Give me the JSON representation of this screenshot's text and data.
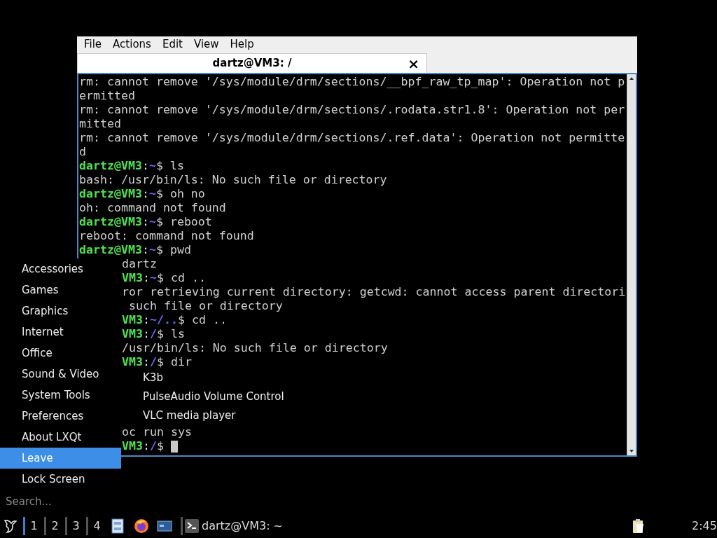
{
  "terminal": {
    "menu_bar": [
      "File",
      "Actions",
      "Edit",
      "View",
      "Help"
    ],
    "tabs": [
      {
        "title": "dartz@VM3: /",
        "selected": true,
        "close": "×"
      }
    ],
    "lines": [
      {
        "kind": "text",
        "text": "rm: cannot remove '/sys/module/drm/sections/__bpf_raw_tp_map': Operation not p"
      },
      {
        "kind": "text",
        "text": "ermitted"
      },
      {
        "kind": "text",
        "text": "rm: cannot remove '/sys/module/drm/sections/.rodata.str1.8': Operation not per"
      },
      {
        "kind": "text",
        "text": "mitted"
      },
      {
        "kind": "text",
        "text": "rm: cannot remove '/sys/module/drm/sections/.ref.data': Operation not permitte"
      },
      {
        "kind": "text",
        "text": "d"
      },
      {
        "kind": "prompt",
        "user": "dartz@VM3",
        "sep": ":",
        "path": "~",
        "tail": "$ ls"
      },
      {
        "kind": "text",
        "text": "bash: /usr/bin/ls: No such file or directory"
      },
      {
        "kind": "prompt",
        "user": "dartz@VM3",
        "sep": ":",
        "path": "~",
        "tail": "$ oh no"
      },
      {
        "kind": "text",
        "text": "oh: command not found"
      },
      {
        "kind": "prompt",
        "user": "dartz@VM3",
        "sep": ":",
        "path": "~",
        "tail": "$ reboot"
      },
      {
        "kind": "text",
        "text": "reboot: command not found"
      },
      {
        "kind": "prompt",
        "user": "dartz@VM3",
        "sep": ":",
        "path": "~",
        "tail": "$ pwd"
      }
    ],
    "lines_beside_menu": [
      {
        "kind": "text",
        "text": "dartz"
      },
      {
        "kind": "prompt",
        "user": "VM3",
        "sep": ":",
        "path": "~",
        "tail": "$ cd .."
      },
      {
        "kind": "text",
        "text": "ror retrieving current directory: getcwd: cannot access parent directori"
      },
      {
        "kind": "text",
        "text": " such file or directory"
      },
      {
        "kind": "prompt",
        "user": "VM3",
        "sep": ":",
        "path": "~/..",
        "tail": "$ cd .."
      },
      {
        "kind": "prompt",
        "user": "VM3",
        "sep": ":",
        "path": "/",
        "tail": "$ ls"
      },
      {
        "kind": "text",
        "text": "/usr/bin/ls: No such file or directory"
      },
      {
        "kind": "prompt",
        "user": "VM3",
        "sep": ":",
        "path": "/",
        "tail": "$ dir"
      }
    ],
    "lines_below_submenu": [
      {
        "kind": "text",
        "text": "oc run sys"
      },
      {
        "kind": "prompt",
        "user": "VM3",
        "sep": ":",
        "path": "/",
        "tail": "$ ",
        "cursor": true
      }
    ]
  },
  "app_menu": {
    "categories": [
      {
        "label": "Accessories",
        "selected": false
      },
      {
        "label": "Games",
        "selected": false
      },
      {
        "label": "Graphics",
        "selected": false
      },
      {
        "label": "Internet",
        "selected": false
      },
      {
        "label": "Office",
        "selected": false
      },
      {
        "label": "Sound & Video",
        "selected": false
      },
      {
        "label": "System Tools",
        "selected": false
      },
      {
        "label": "Preferences",
        "selected": false
      },
      {
        "label": "About LXQt",
        "selected": false
      },
      {
        "label": "Leave",
        "selected": true
      },
      {
        "label": "Lock Screen",
        "selected": false
      }
    ],
    "submenu": [
      "K3b",
      "PulseAudio Volume Control",
      "VLC media player"
    ],
    "search": {
      "placeholder": "Search..."
    }
  },
  "taskbar": {
    "desktops": [
      {
        "label": "1",
        "selected": true
      },
      {
        "label": "2",
        "selected": false
      },
      {
        "label": "3",
        "selected": false
      },
      {
        "label": "4",
        "selected": false
      }
    ],
    "tasks": [
      {
        "title": "dartz@VM3: ~"
      }
    ],
    "clock": "2:45"
  }
}
